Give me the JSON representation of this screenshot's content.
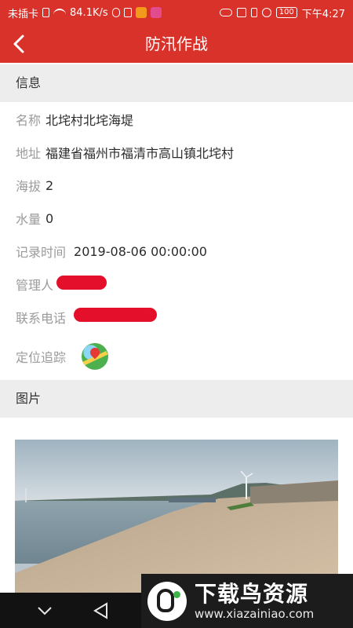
{
  "status_bar": {
    "carrier": "未插卡",
    "speed": "84.1K/s",
    "battery": "100",
    "time": "下午4:27"
  },
  "header": {
    "title": "防汛作战"
  },
  "info_section": {
    "title": "信息",
    "fields": [
      {
        "label": "名称",
        "value": "北垞村北垞海堤"
      },
      {
        "label": "地址",
        "value": "福建省福州市福清市高山镇北垞村"
      },
      {
        "label": "海拔",
        "value": "2"
      },
      {
        "label": "水量",
        "value": "0"
      },
      {
        "label": "记录时间",
        "value": "2019-08-06 00:00:00"
      },
      {
        "label": "管理人",
        "value": ""
      },
      {
        "label": "联系电话",
        "value": ""
      },
      {
        "label": "定位追踪",
        "value": ""
      }
    ]
  },
  "image_section": {
    "title": "图片"
  },
  "watermark": {
    "title": "下载鸟资源",
    "url": "www.xiazainiao.com"
  },
  "colors": {
    "primary": "#d9322b",
    "section_bg": "#ededed",
    "label": "#9b9b9b",
    "redaction": "#e4102b"
  }
}
